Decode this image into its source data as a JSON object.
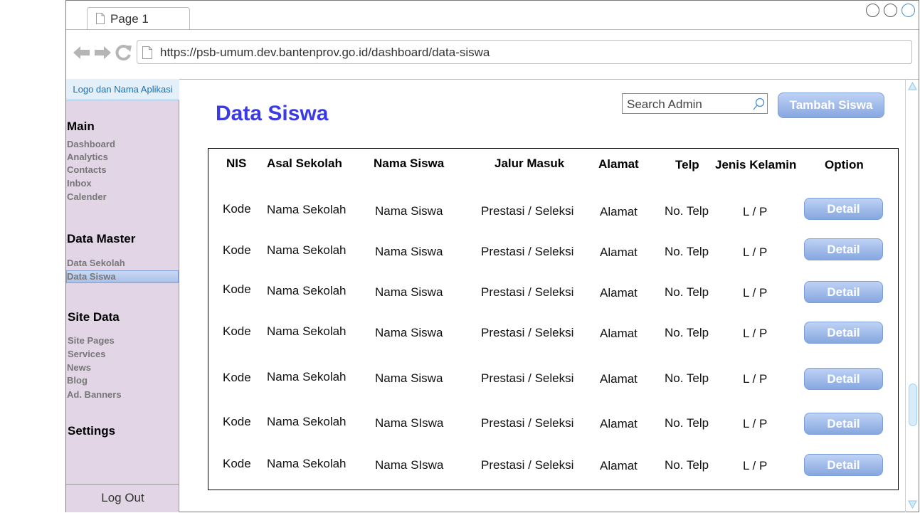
{
  "browser": {
    "tab_label": "Page 1",
    "url": "https://psb-umum.dev.bantenprov.go.id/dashboard/data-siswa"
  },
  "sidebar": {
    "logo_text": "Logo dan Nama Aplikasi",
    "sections": [
      {
        "title": "Main",
        "items": [
          "Dashboard",
          "Analytics",
          "Contacts",
          "Inbox",
          "Calender"
        ]
      },
      {
        "title": "Data Master",
        "items": [
          "Data Sekolah",
          "Data Siswa"
        ]
      },
      {
        "title": "Site Data",
        "items": [
          "Site Pages",
          "Services",
          "News",
          "Blog",
          "Ad. Banners"
        ]
      },
      {
        "title": "Settings",
        "items": []
      }
    ],
    "active_item": "Data Siswa",
    "logout_label": "Log Out"
  },
  "main": {
    "title": "Data Siswa",
    "search_placeholder": "Search Admin",
    "add_button_label": "Tambah Siswa"
  },
  "table": {
    "headers": [
      "NIS",
      "Asal Sekolah",
      "Nama Siswa",
      "Jalur Masuk",
      "Alamat",
      "Telp",
      "Jenis Kelamin",
      "Option"
    ],
    "rows": [
      [
        "Kode",
        "Nama Sekolah",
        "Nama Siswa",
        "Prestasi / Seleksi",
        "Alamat",
        "No. Telp",
        "L / P",
        "Detail"
      ],
      [
        "Kode",
        "Nama Sekolah",
        "Nama Siswa",
        "Prestasi / Seleksi",
        "Alamat",
        "No. Telp",
        "L / P",
        "Detail"
      ],
      [
        "Kode",
        "Nama Sekolah",
        "Nama Siswa",
        "Prestasi / Seleksi",
        "Alamat",
        "No. Telp",
        "L / P",
        "Detail"
      ],
      [
        "Kode",
        "Nama Sekolah",
        "Nama Siswa",
        "Prestasi / Seleksi",
        "Alamat",
        "No. Telp",
        "L / P",
        "Detail"
      ],
      [
        "Kode",
        "Nama Sekolah",
        "Nama Siswa",
        "Prestasi / Seleksi",
        "Alamat",
        "No. Telp",
        "L / P",
        "Detail"
      ],
      [
        "Kode",
        "Nama Sekolah",
        "Nama SIswa",
        "Prestasi / Seleksi",
        "Alamat",
        "No. Telp",
        "L / P",
        "Detail"
      ],
      [
        "Kode",
        "Nama Sekolah",
        "Nama SIswa",
        "Prestasi / Seleksi",
        "Alamat",
        "No. Telp",
        "L / P",
        "Detail"
      ]
    ]
  },
  "colors": {
    "title": "#3a3ae6",
    "sidebar_bg": "#e1d5e6",
    "button_top": "#bfd2f4",
    "button_bottom": "#86a7e0"
  }
}
